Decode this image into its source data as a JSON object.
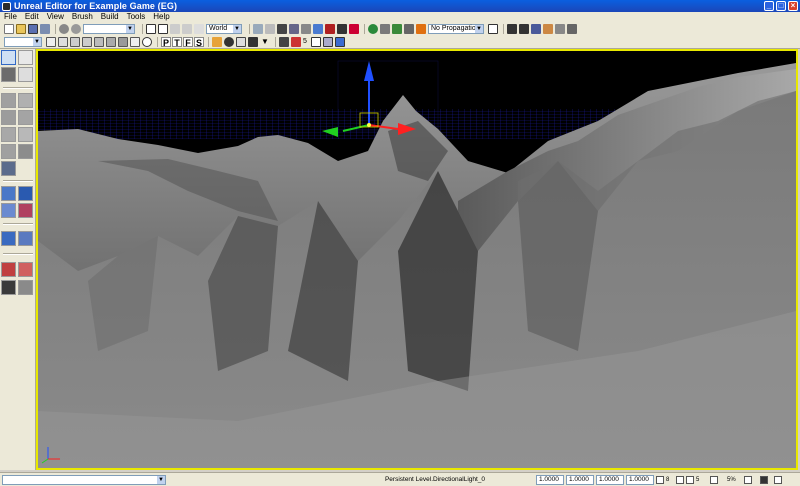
{
  "window": {
    "title": "Unreal Editor for Example Game (EG)"
  },
  "menu": [
    "File",
    "Edit",
    "View",
    "Brush",
    "Build",
    "Tools",
    "Help"
  ],
  "toolbar": {
    "coord_system": "World",
    "propagation": "No Propagation",
    "view_mode_letters": [
      "P",
      "T",
      "F",
      "S"
    ],
    "snap_value": "5"
  },
  "statusbar": {
    "status_text": "Persistent Level.DirectionalLight_0",
    "coords": [
      "1.0000",
      "1.0000",
      "1.0000",
      "1.0000"
    ],
    "grid_value": "8",
    "rot_value": "5",
    "scale_value": "5%"
  },
  "colors": {
    "viewport_border": "#e8e800",
    "title_bar": "#0a5fe0",
    "axis_x": "#ff2020",
    "axis_y": "#20d020",
    "axis_z": "#2050ff"
  },
  "icons": [
    "new-icon",
    "open-icon",
    "save-icon",
    "undo-icon",
    "redo-icon",
    "select-icon",
    "translate-icon",
    "rotate-icon",
    "scale-icon",
    "build-icon",
    "play-icon",
    "camera-icon"
  ]
}
